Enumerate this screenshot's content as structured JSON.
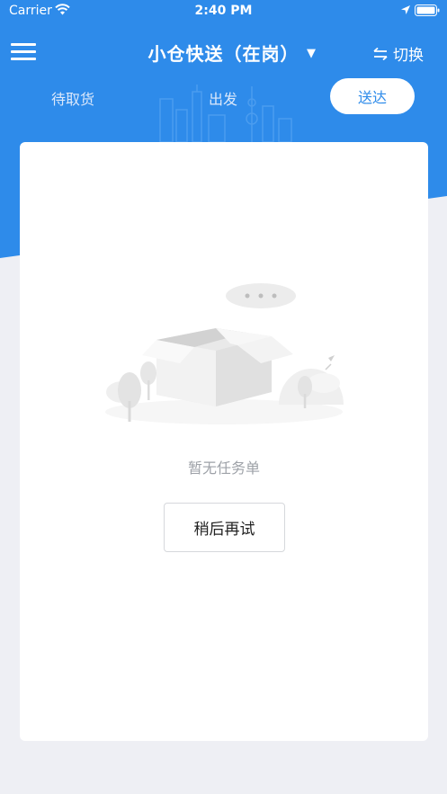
{
  "status_bar": {
    "carrier": "Carrier",
    "time": "2:40 PM"
  },
  "header": {
    "title": "小仓快送（在岗）",
    "switch_label": "切换"
  },
  "tabs": [
    {
      "label": "待取货",
      "active": false
    },
    {
      "label": "出发",
      "active": false
    },
    {
      "label": "送达",
      "active": true
    }
  ],
  "empty_state": {
    "message": "暂无任务单",
    "retry_label": "稍后再试"
  },
  "colors": {
    "brand": "#2e8bea",
    "background": "#eeeff4"
  }
}
